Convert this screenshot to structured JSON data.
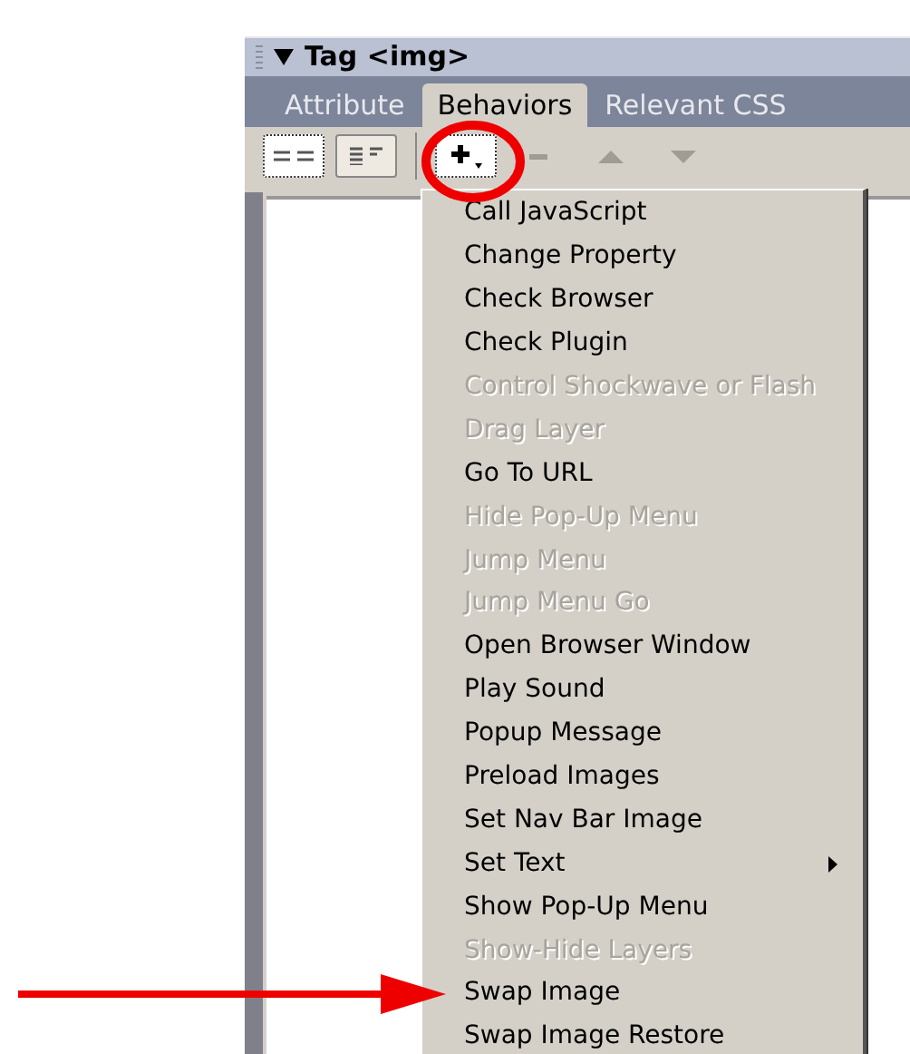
{
  "panel": {
    "title": "Tag <img>",
    "expanded": true
  },
  "tabs": [
    {
      "label": "Attribute",
      "selected": false
    },
    {
      "label": "Behaviors",
      "selected": true
    },
    {
      "label": "Relevant CSS",
      "selected": false
    }
  ],
  "toolbar": [
    {
      "kind": "grid-view",
      "selected": true
    },
    {
      "kind": "list-view",
      "selected": false
    },
    {
      "kind": "add",
      "disabled": false
    },
    {
      "kind": "remove",
      "disabled": true
    },
    {
      "kind": "move-up",
      "disabled": true
    },
    {
      "kind": "move-down",
      "disabled": true
    }
  ],
  "menu": [
    {
      "label": "Call JavaScript",
      "disabled": false
    },
    {
      "label": "Change Property",
      "disabled": false
    },
    {
      "label": "Check Browser",
      "disabled": false
    },
    {
      "label": "Check Plugin",
      "disabled": false
    },
    {
      "label": "Control Shockwave or Flash",
      "disabled": true
    },
    {
      "label": "Drag Layer",
      "disabled": true
    },
    {
      "label": "Go To URL",
      "disabled": false
    },
    {
      "label": "Hide Pop-Up Menu",
      "disabled": true
    },
    {
      "label": "Jump Menu",
      "disabled": true
    },
    {
      "label": "Jump Menu Go",
      "disabled": true
    },
    {
      "label": "Open Browser Window",
      "disabled": false
    },
    {
      "label": "Play Sound",
      "disabled": false
    },
    {
      "label": "Popup Message",
      "disabled": false
    },
    {
      "label": "Preload Images",
      "disabled": false
    },
    {
      "label": "Set Nav Bar Image",
      "disabled": false
    },
    {
      "label": "Set Text",
      "disabled": false,
      "submenu": true
    },
    {
      "label": "Show Pop-Up Menu",
      "disabled": false
    },
    {
      "label": "Show-Hide Layers",
      "disabled": true
    },
    {
      "label": "Swap Image",
      "disabled": false
    },
    {
      "label": "Swap Image Restore",
      "disabled": false
    }
  ]
}
